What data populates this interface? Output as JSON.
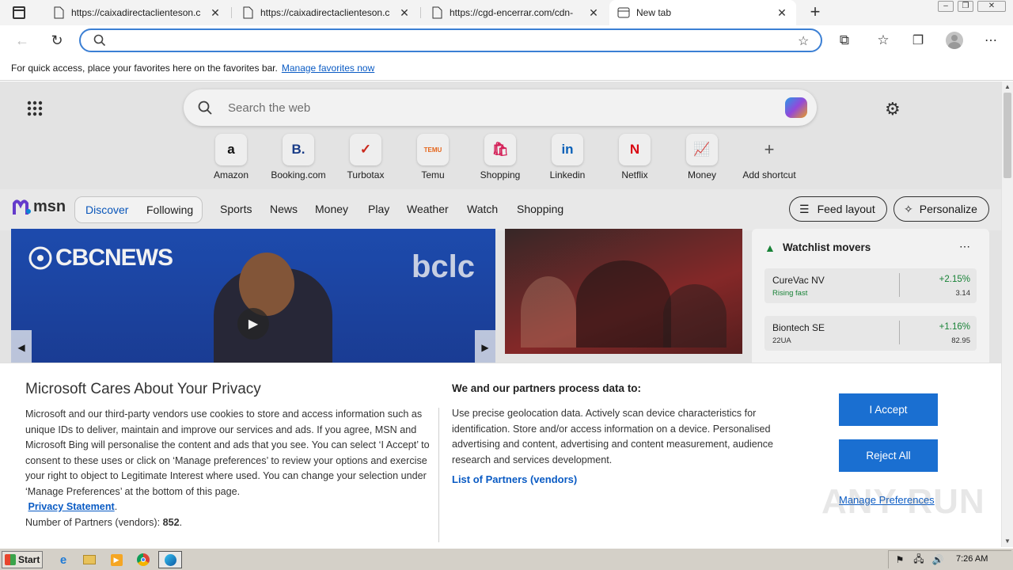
{
  "tabs": [
    {
      "title": "https://caixadirectaclienteson.c",
      "icon": "page-icon"
    },
    {
      "title": "https://caixadirectaclienteson.c",
      "icon": "page-icon"
    },
    {
      "title": "https://cgd-encerrar.com/cdn-",
      "icon": "page-icon"
    },
    {
      "title": "New tab",
      "icon": "newtab-icon",
      "active": true
    }
  ],
  "address_bar": {
    "value": "",
    "placeholder": ""
  },
  "favorites_bar": {
    "message": "For quick access, place your favorites here on the favorites bar.",
    "link": "Manage favorites now"
  },
  "newtab": {
    "search_placeholder": "Search the web",
    "shortcuts": [
      {
        "label": "Amazon",
        "glyph": "a",
        "color": "#111111"
      },
      {
        "label": "Booking.com",
        "glyph": "B.",
        "color": "#1a3f8f"
      },
      {
        "label": "Turbotax",
        "glyph": "✓",
        "color": "#d52b1e"
      },
      {
        "label": "Temu",
        "glyph": "TEMU",
        "color": "#f26b1d"
      },
      {
        "label": "Shopping",
        "glyph": "🛍",
        "color": "#e0245e"
      },
      {
        "label": "Linkedin",
        "glyph": "in",
        "color": "#0a66c2"
      },
      {
        "label": "Netflix",
        "glyph": "N",
        "color": "#e50914"
      },
      {
        "label": "Money",
        "glyph": "📈",
        "color": "#222222"
      },
      {
        "label": "Add shortcut",
        "glyph": "+",
        "color": "#555555"
      }
    ]
  },
  "msn": {
    "logo": "msn",
    "tabs": [
      "Discover",
      "Following"
    ],
    "nav": [
      "Sports",
      "News",
      "Money",
      "Play",
      "Weather",
      "Watch",
      "Shopping"
    ],
    "feed_layout": "Feed layout",
    "personalize": "Personalize"
  },
  "hero": {
    "brand": "CBCNEWS",
    "watermark": "bclc"
  },
  "watchlist": {
    "title": "Watchlist movers",
    "items": [
      {
        "name": "CureVac NV",
        "sub": "Rising fast",
        "change": "+2.15%",
        "price": "3.14"
      },
      {
        "name": "Biontech SE",
        "sub": "22UA",
        "change": "+1.16%",
        "price": "82.95"
      }
    ]
  },
  "privacy": {
    "title": "Microsoft Cares About Your Privacy",
    "body": "Microsoft and our third-party vendors use cookies to store and access information such as unique IDs to deliver, maintain and improve our services and ads. If you agree, MSN and Microsoft Bing will personalise the content and ads that you see. You can select ‘I Accept’ to consent to these uses or click on ‘Manage preferences’ to review your options and exercise your right to object to Legitimate Interest where used.  You can change your selection under ‘Manage Preferences’ at the bottom of this page.",
    "privacy_link": "Privacy Statement",
    "partners_label": "Number of Partners (vendors):",
    "partners_count": "852",
    "purpose_title": "We and our partners process data to:",
    "purpose_text": "Use precise geolocation data. Actively scan device characteristics for identification. Store and/or access information on a device. Personalised advertising and content, advertising and content measurement, audience research and services development.",
    "partners_link": "List of Partners (vendors)",
    "accept": "I Accept",
    "reject": "Reject All",
    "manage": "Manage Preferences"
  },
  "taskbar": {
    "start": "Start",
    "time": "7:26 AM"
  },
  "watermark": "ANY RUN"
}
